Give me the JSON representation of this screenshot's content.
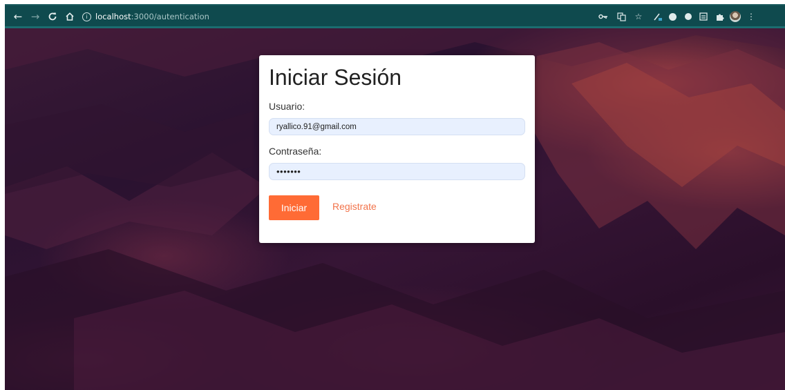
{
  "browser": {
    "url_host": "localhost",
    "url_path": ":3000/autentication",
    "nav": {
      "back_icon": "back-arrow-icon",
      "forward_icon": "forward-arrow-icon",
      "reload_icon": "reload-icon",
      "home_icon": "home-icon"
    },
    "toolbar_icons": [
      "key-icon",
      "translate-icon",
      "star-icon",
      "extension-icon",
      "extension-icon",
      "extension-icon",
      "extension-icon",
      "puzzle-icon",
      "avatar",
      "kebab-menu-icon"
    ]
  },
  "login": {
    "title": "Iniciar Sesión",
    "username_label": "Usuario:",
    "username_value": "ryallico.91@gmail.com",
    "password_label": "Contraseña:",
    "password_value": "•••••••",
    "submit_label": "Iniciar",
    "register_label": "Registrate"
  },
  "colors": {
    "accent": "#ff6b35",
    "link": "#f2734a",
    "input_bg": "#e8f0fe",
    "chrome_bg": "#0f4a4e"
  }
}
